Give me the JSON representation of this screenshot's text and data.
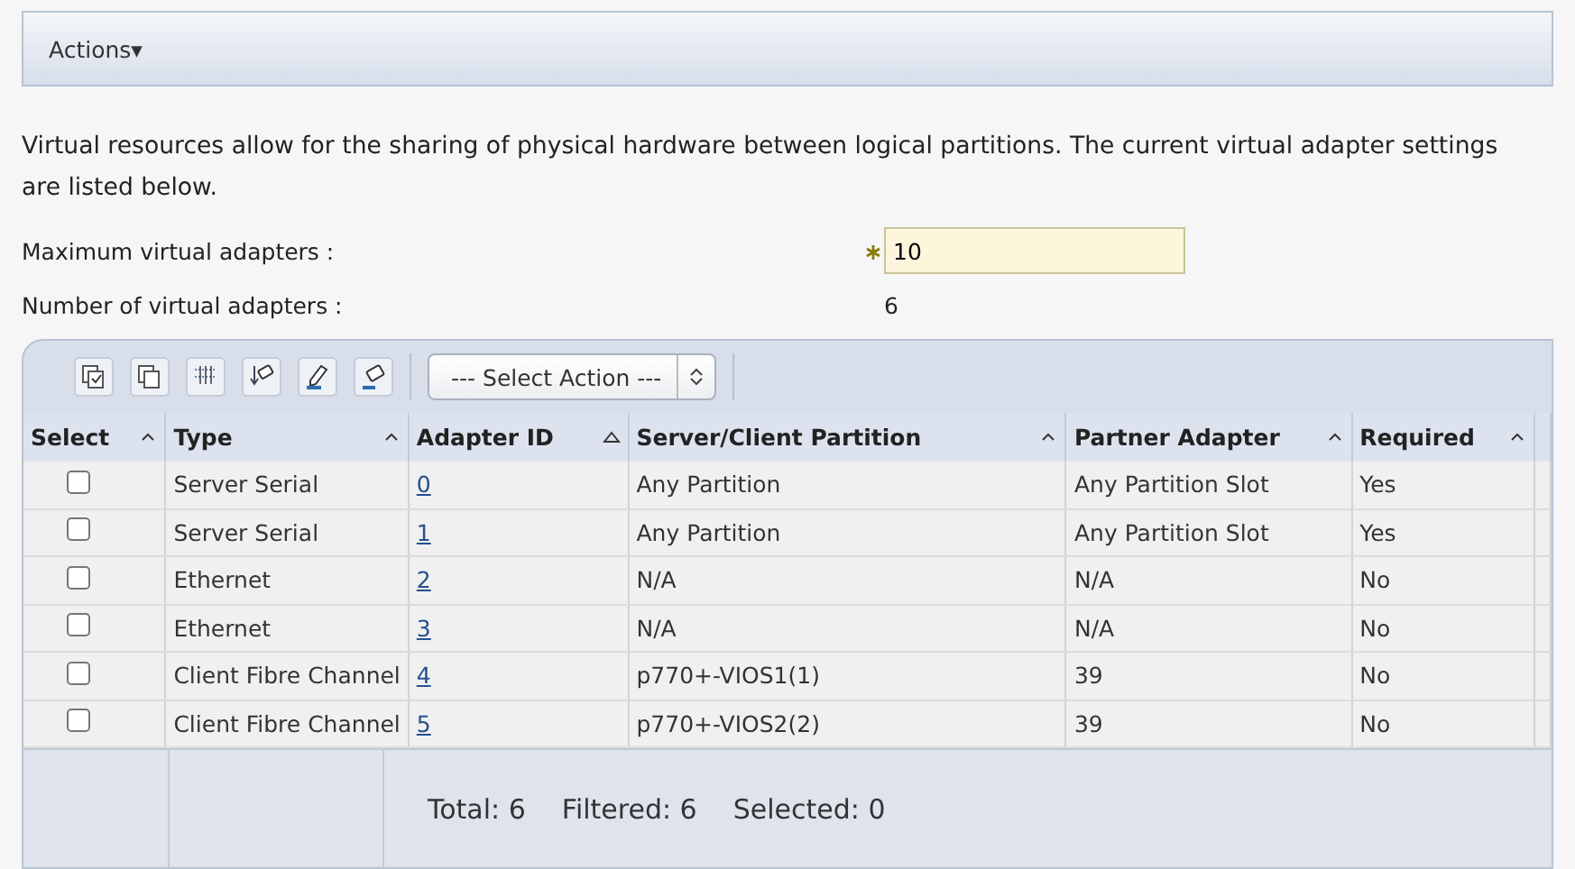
{
  "actions_menu": {
    "label": "Actions",
    "caret": "▾"
  },
  "description": "Virtual resources allow for the sharing of physical hardware between logical partitions. The current virtual adapter settings are listed below.",
  "fields": [
    {
      "kind": "input",
      "label": "Maximum virtual adapters :",
      "required": true,
      "value": "10"
    },
    {
      "kind": "readonly",
      "label": "Number of virtual adapters :",
      "value": "6"
    }
  ],
  "toolbar": {
    "select_action": "--- Select Action ---"
  },
  "table": {
    "columns": [
      {
        "label": "Select",
        "sorted": false
      },
      {
        "label": "Type",
        "sorted": false
      },
      {
        "label": "Adapter ID",
        "sorted": true
      },
      {
        "label": "Server/Client Partition",
        "sorted": false
      },
      {
        "label": "Partner Adapter",
        "sorted": false
      },
      {
        "label": "Required",
        "sorted": false
      }
    ],
    "rows": [
      {
        "checked": false,
        "type": "Server Serial",
        "adapter_id": "0",
        "partition": "Any Partition",
        "partner": "Any Partition Slot",
        "required": "Yes"
      },
      {
        "checked": false,
        "type": "Server Serial",
        "adapter_id": "1",
        "partition": "Any Partition",
        "partner": "Any Partition Slot",
        "required": "Yes"
      },
      {
        "checked": false,
        "type": "Ethernet",
        "adapter_id": "2",
        "partition": "N/A",
        "partner": "N/A",
        "required": "No"
      },
      {
        "checked": false,
        "type": "Ethernet",
        "adapter_id": "3",
        "partition": "N/A",
        "partner": "N/A",
        "required": "No"
      },
      {
        "checked": false,
        "type": "Client Fibre Channel",
        "adapter_id": "4",
        "partition": "p770+-VIOS1(1)",
        "partner": "39",
        "required": "No"
      },
      {
        "checked": false,
        "type": "Client Fibre Channel",
        "adapter_id": "5",
        "partition": "p770+-VIOS2(2)",
        "partner": "39",
        "required": "No"
      }
    ],
    "footer": {
      "total": "Total: 6",
      "filtered": "Filtered: 6",
      "selected": "Selected: 0"
    }
  }
}
